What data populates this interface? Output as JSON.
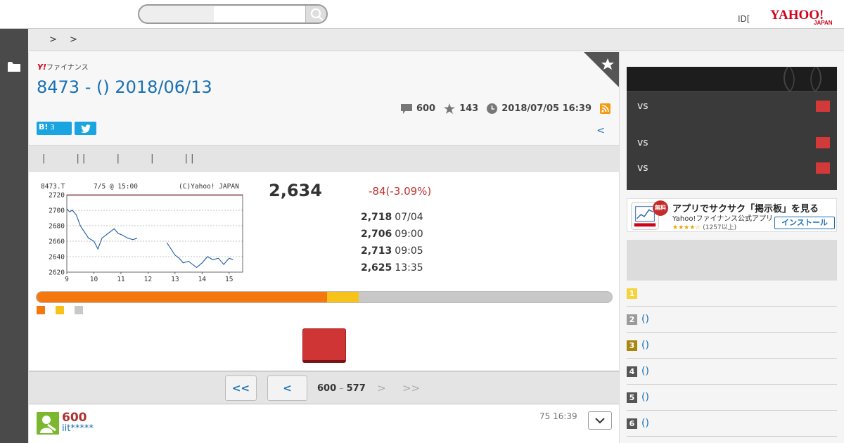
{
  "header": {
    "search_placeholder": "",
    "id_link": "ID[",
    "logo_text": "YAHOO!",
    "logo_sub": "JAPAN"
  },
  "breadcrumb": {
    "items": [
      ">",
      ">"
    ]
  },
  "finance_logo": {
    "mark": "Y!",
    "text": "ファイナンス"
  },
  "page_title": "8473 - () 2018/06/13",
  "meta": {
    "comments": "600",
    "favorites": "143",
    "updated": "2018/07/05 16:39"
  },
  "share": {
    "hatena_label": "B!",
    "hatena_count": "3"
  },
  "prev_link": "<",
  "tabs": [
    "|",
    "| |",
    "|",
    "|",
    "| |"
  ],
  "chart": {
    "ticker_label": "8473.T",
    "date_label": "7/5 @ 15:00",
    "copyright": "(C)Yahoo! JAPAN"
  },
  "chart_data": {
    "type": "line",
    "x_ticks": [
      "9",
      "10",
      "11",
      "12",
      "13",
      "14",
      "15"
    ],
    "y_ticks": [
      2620,
      2640,
      2660,
      2680,
      2700,
      2720
    ],
    "ylim": [
      2620,
      2720
    ],
    "xlim": [
      9,
      15.5
    ],
    "grid": true,
    "x": [
      9.0,
      9.1,
      9.2,
      9.35,
      9.5,
      9.65,
      9.8,
      10.0,
      10.15,
      10.3,
      10.45,
      10.6,
      10.75,
      10.9,
      11.05,
      11.25,
      11.45,
      11.6,
      12.7,
      12.85,
      13.0,
      13.15,
      13.3,
      13.5,
      13.65,
      13.8,
      14.0,
      14.2,
      14.4,
      14.6,
      14.8,
      15.0,
      15.15
    ],
    "y": [
      2702,
      2698,
      2700,
      2694,
      2680,
      2672,
      2664,
      2660,
      2650,
      2664,
      2668,
      2672,
      2676,
      2670,
      2668,
      2664,
      2662,
      2664,
      2658,
      2650,
      2642,
      2638,
      2632,
      2634,
      2630,
      2626,
      2632,
      2640,
      2636,
      2638,
      2630,
      2638,
      2636
    ]
  },
  "quote": {
    "price": "2,634",
    "change": "-84(-3.09%)",
    "ohlc": [
      {
        "value": "2,718",
        "label": "07/04"
      },
      {
        "value": "2,706",
        "label": "09:00"
      },
      {
        "value": "2,713",
        "label": "09:05"
      },
      {
        "value": "2,625",
        "label": "13:35"
      }
    ]
  },
  "sentiment": {
    "buy_pct": 50.5,
    "hold_pct": 5.5
  },
  "colors": {
    "buy": "#f5780f",
    "hold": "#f7c21a",
    "sell": "#c8c8c8",
    "link": "#1a6fb3",
    "accent_red": "#cf3535"
  },
  "pager": {
    "first": "<<",
    "prev": "<",
    "range_start": "600",
    "range_sep": "–",
    "range_end": "577",
    "next": ">",
    "last": ">>"
  },
  "comment": {
    "number": "600",
    "user": "iit*****",
    "time": "75 16:39"
  },
  "sidebar": {
    "sport_rows": [
      "vs",
      "vs",
      "vs"
    ],
    "app_ad": {
      "badge": "無料",
      "title": "アプリでサクサク「掲示板」を見る",
      "subtitle": "Yahoo!ファイナンス公式アプリ",
      "stars": "★★★★☆",
      "rating": "(1257以上)",
      "install": "インストール"
    },
    "ranking": [
      {
        "rank": "1",
        "text": "",
        "color": "#f5d33a"
      },
      {
        "rank": "2",
        "text": "()",
        "color": "#9b9b9b"
      },
      {
        "rank": "3",
        "text": "()",
        "color": "#a8860f"
      },
      {
        "rank": "4",
        "text": "()",
        "color": "#555555"
      },
      {
        "rank": "5",
        "text": "()",
        "color": "#555555"
      },
      {
        "rank": "6",
        "text": "()",
        "color": "#555555"
      }
    ]
  }
}
